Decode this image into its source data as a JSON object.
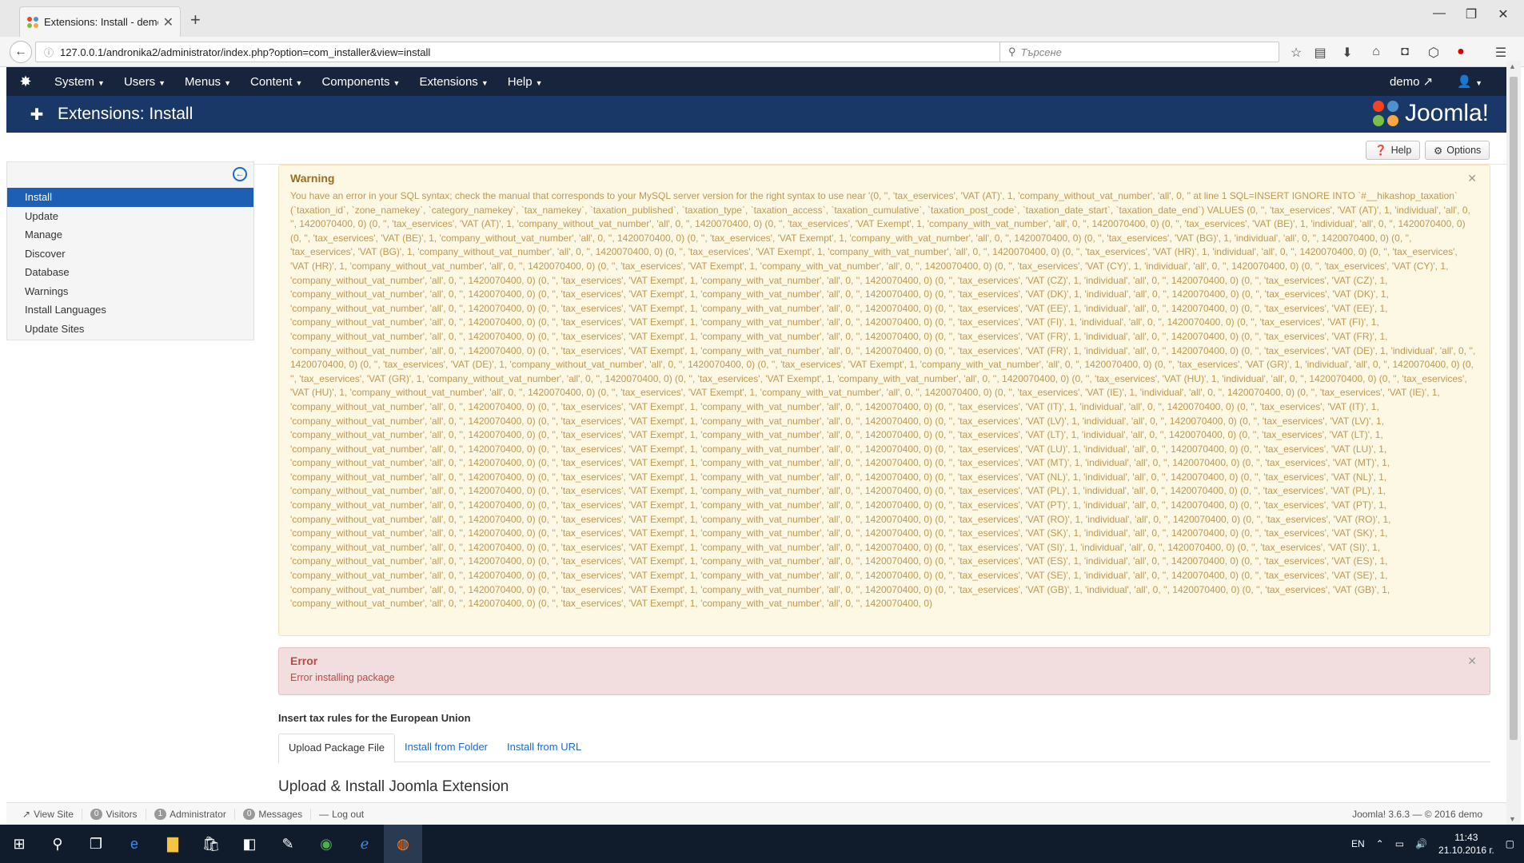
{
  "browser": {
    "tab_title": "Extensions: Install - demo ...",
    "url": "127.0.0.1/andronika2/administrator/index.php?option=com_installer&view=install",
    "search_placeholder": "Търсене"
  },
  "nav": {
    "menu": [
      {
        "label": "System"
      },
      {
        "label": "Users"
      },
      {
        "label": "Menus"
      },
      {
        "label": "Content"
      },
      {
        "label": "Components"
      },
      {
        "label": "Extensions"
      },
      {
        "label": "Help"
      }
    ],
    "user_site": "demo",
    "brand": "Joomla!"
  },
  "header": {
    "title": "Extensions: Install"
  },
  "toolbar": {
    "help_label": "Help",
    "options_label": "Options"
  },
  "sidebar": {
    "items": [
      {
        "label": "Install",
        "active": true
      },
      {
        "label": "Update"
      },
      {
        "label": "Manage"
      },
      {
        "label": "Discover"
      },
      {
        "label": "Database"
      },
      {
        "label": "Warnings"
      },
      {
        "label": "Install Languages"
      },
      {
        "label": "Update Sites"
      }
    ]
  },
  "warning": {
    "title": "Warning",
    "body": "You have an error in your SQL syntax; check the manual that corresponds to your MySQL server version for the right syntax to use near '(0, '', 'tax_eservices', 'VAT (AT)', 1, 'company_without_vat_number', 'all', 0, '' at line 1 SQL=INSERT IGNORE INTO `#__hikashop_taxation` (`taxation_id`, `zone_namekey`, `category_namekey`, `tax_namekey`, `taxation_published`, `taxation_type`, `taxation_access`, `taxation_cumulative`, `taxation_post_code`, `taxation_date_start`, `taxation_date_end`) VALUES (0, '', 'tax_eservices', 'VAT (AT)', 1, 'individual', 'all', 0, '', 1420070400, 0) (0, '', 'tax_eservices', 'VAT (AT)', 1, 'company_without_vat_number', 'all', 0, '', 1420070400, 0) (0, '', 'tax_eservices', 'VAT Exempt', 1, 'company_with_vat_number', 'all', 0, '', 1420070400, 0) (0, '', 'tax_eservices', 'VAT (BE)', 1, 'individual', 'all', 0, '', 1420070400, 0) (0, '', 'tax_eservices', 'VAT (BE)', 1, 'company_without_vat_number', 'all', 0, '', 1420070400, 0) (0, '', 'tax_eservices', 'VAT Exempt', 1, 'company_with_vat_number', 'all', 0, '', 1420070400, 0) (0, '', 'tax_eservices', 'VAT (BG)', 1, 'individual', 'all', 0, '', 1420070400, 0) (0, '', 'tax_eservices', 'VAT (BG)', 1, 'company_without_vat_number', 'all', 0, '', 1420070400, 0) (0, '', 'tax_eservices', 'VAT Exempt', 1, 'company_with_vat_number', 'all', 0, '', 1420070400, 0) (0, '', 'tax_eservices', 'VAT (HR)', 1, 'individual', 'all', 0, '', 1420070400, 0) (0, '', 'tax_eservices', 'VAT (HR)', 1, 'company_without_vat_number', 'all', 0, '', 1420070400, 0) (0, '', 'tax_eservices', 'VAT Exempt', 1, 'company_with_vat_number', 'all', 0, '', 1420070400, 0) (0, '', 'tax_eservices', 'VAT (CY)', 1, 'individual', 'all', 0, '', 1420070400, 0) (0, '', 'tax_eservices', 'VAT (CY)', 1, 'company_without_vat_number', 'all', 0, '', 1420070400, 0) (0, '', 'tax_eservices', 'VAT Exempt', 1, 'company_with_vat_number', 'all', 0, '', 1420070400, 0) (0, '', 'tax_eservices', 'VAT (CZ)', 1, 'individual', 'all', 0, '', 1420070400, 0) (0, '', 'tax_eservices', 'VAT (CZ)', 1, 'company_without_vat_number', 'all', 0, '', 1420070400, 0) (0, '', 'tax_eservices', 'VAT Exempt', 1, 'company_with_vat_number', 'all', 0, '', 1420070400, 0) (0, '', 'tax_eservices', 'VAT (DK)', 1, 'individual', 'all', 0, '', 1420070400, 0) (0, '', 'tax_eservices', 'VAT (DK)', 1, 'company_without_vat_number', 'all', 0, '', 1420070400, 0) (0, '', 'tax_eservices', 'VAT Exempt', 1, 'company_with_vat_number', 'all', 0, '', 1420070400, 0) (0, '', 'tax_eservices', 'VAT (EE)', 1, 'individual', 'all', 0, '', 1420070400, 0) (0, '', 'tax_eservices', 'VAT (EE)', 1, 'company_without_vat_number', 'all', 0, '', 1420070400, 0) (0, '', 'tax_eservices', 'VAT Exempt', 1, 'company_with_vat_number', 'all', 0, '', 1420070400, 0) (0, '', 'tax_eservices', 'VAT (FI)', 1, 'individual', 'all', 0, '', 1420070400, 0) (0, '', 'tax_eservices', 'VAT (FI)', 1, 'company_without_vat_number', 'all', 0, '', 1420070400, 0) (0, '', 'tax_eservices', 'VAT Exempt', 1, 'company_with_vat_number', 'all', 0, '', 1420070400, 0) (0, '', 'tax_eservices', 'VAT (FR)', 1, 'individual', 'all', 0, '', 1420070400, 0) (0, '', 'tax_eservices', 'VAT (FR)', 1, 'company_without_vat_number', 'all', 0, '', 1420070400, 0) (0, '', 'tax_eservices', 'VAT Exempt', 1, 'company_with_vat_number', 'all', 0, '', 1420070400, 0) (0, '', 'tax_eservices', 'VAT (FR)', 1, 'individual', 'all', 0, '', 1420070400, 0) (0, '', 'tax_eservices', 'VAT (DE)', 1, 'individual', 'all', 0, '', 1420070400, 0) (0, '', 'tax_eservices', 'VAT (DE)', 1, 'company_without_vat_number', 'all', 0, '', 1420070400, 0) (0, '', 'tax_eservices', 'VAT Exempt', 1, 'company_with_vat_number', 'all', 0, '', 1420070400, 0) (0, '', 'tax_eservices', 'VAT (GR)', 1, 'individual', 'all', 0, '', 1420070400, 0) (0, '', 'tax_eservices', 'VAT (GR)', 1, 'company_without_vat_number', 'all', 0, '', 1420070400, 0) (0, '', 'tax_eservices', 'VAT Exempt', 1, 'company_with_vat_number', 'all', 0, '', 1420070400, 0) (0, '', 'tax_eservices', 'VAT (HU)', 1, 'individual', 'all', 0, '', 1420070400, 0) (0, '', 'tax_eservices', 'VAT (HU)', 1, 'company_without_vat_number', 'all', 0, '', 1420070400, 0) (0, '', 'tax_eservices', 'VAT Exempt', 1, 'company_with_vat_number', 'all', 0, '', 1420070400, 0) (0, '', 'tax_eservices', 'VAT (IE)', 1, 'individual', 'all', 0, '', 1420070400, 0) (0, '', 'tax_eservices', 'VAT (IE)', 1, 'company_without_vat_number', 'all', 0, '', 1420070400, 0) (0, '', 'tax_eservices', 'VAT Exempt', 1, 'company_with_vat_number', 'all', 0, '', 1420070400, 0) (0, '', 'tax_eservices', 'VAT (IT)', 1, 'individual', 'all', 0, '', 1420070400, 0) (0, '', 'tax_eservices', 'VAT (IT)', 1, 'company_without_vat_number', 'all', 0, '', 1420070400, 0) (0, '', 'tax_eservices', 'VAT Exempt', 1, 'company_with_vat_number', 'all', 0, '', 1420070400, 0) (0, '', 'tax_eservices', 'VAT (LV)', 1, 'individual', 'all', 0, '', 1420070400, 0) (0, '', 'tax_eservices', 'VAT (LV)', 1, 'company_without_vat_number', 'all', 0, '', 1420070400, 0) (0, '', 'tax_eservices', 'VAT Exempt', 1, 'company_with_vat_number', 'all', 0, '', 1420070400, 0) (0, '', 'tax_eservices', 'VAT (LT)', 1, 'individual', 'all', 0, '', 1420070400, 0) (0, '', 'tax_eservices', 'VAT (LT)', 1, 'company_without_vat_number', 'all', 0, '', 1420070400, 0) (0, '', 'tax_eservices', 'VAT Exempt', 1, 'company_with_vat_number', 'all', 0, '', 1420070400, 0) (0, '', 'tax_eservices', 'VAT (LU)', 1, 'individual', 'all', 0, '', 1420070400, 0) (0, '', 'tax_eservices', 'VAT (LU)', 1, 'company_without_vat_number', 'all', 0, '', 1420070400, 0) (0, '', 'tax_eservices', 'VAT Exempt', 1, 'company_with_vat_number', 'all', 0, '', 1420070400, 0) (0, '', 'tax_eservices', 'VAT (MT)', 1, 'individual', 'all', 0, '', 1420070400, 0) (0, '', 'tax_eservices', 'VAT (MT)', 1, 'company_without_vat_number', 'all', 0, '', 1420070400, 0) (0, '', 'tax_eservices', 'VAT Exempt', 1, 'company_with_vat_number', 'all', 0, '', 1420070400, 0) (0, '', 'tax_eservices', 'VAT (NL)', 1, 'individual', 'all', 0, '', 1420070400, 0) (0, '', 'tax_eservices', 'VAT (NL)', 1, 'company_without_vat_number', 'all', 0, '', 1420070400, 0) (0, '', 'tax_eservices', 'VAT Exempt', 1, 'company_with_vat_number', 'all', 0, '', 1420070400, 0) (0, '', 'tax_eservices', 'VAT (PL)', 1, 'individual', 'all', 0, '', 1420070400, 0) (0, '', 'tax_eservices', 'VAT (PL)', 1, 'company_without_vat_number', 'all', 0, '', 1420070400, 0) (0, '', 'tax_eservices', 'VAT Exempt', 1, 'company_with_vat_number', 'all', 0, '', 1420070400, 0) (0, '', 'tax_eservices', 'VAT (PT)', 1, 'individual', 'all', 0, '', 1420070400, 0) (0, '', 'tax_eservices', 'VAT (PT)', 1, 'company_without_vat_number', 'all', 0, '', 1420070400, 0) (0, '', 'tax_eservices', 'VAT Exempt', 1, 'company_with_vat_number', 'all', 0, '', 1420070400, 0) (0, '', 'tax_eservices', 'VAT (RO)', 1, 'individual', 'all', 0, '', 1420070400, 0) (0, '', 'tax_eservices', 'VAT (RO)', 1, 'company_without_vat_number', 'all', 0, '', 1420070400, 0) (0, '', 'tax_eservices', 'VAT Exempt', 1, 'company_with_vat_number', 'all', 0, '', 1420070400, 0) (0, '', 'tax_eservices', 'VAT (SK)', 1, 'individual', 'all', 0, '', 1420070400, 0) (0, '', 'tax_eservices', 'VAT (SK)', 1, 'company_without_vat_number', 'all', 0, '', 1420070400, 0) (0, '', 'tax_eservices', 'VAT Exempt', 1, 'company_with_vat_number', 'all', 0, '', 1420070400, 0) (0, '', 'tax_eservices', 'VAT (SI)', 1, 'individual', 'all', 0, '', 1420070400, 0) (0, '', 'tax_eservices', 'VAT (SI)', 1, 'company_without_vat_number', 'all', 0, '', 1420070400, 0) (0, '', 'tax_eservices', 'VAT Exempt', 1, 'company_with_vat_number', 'all', 0, '', 1420070400, 0) (0, '', 'tax_eservices', 'VAT (ES)', 1, 'individual', 'all', 0, '', 1420070400, 0) (0, '', 'tax_eservices', 'VAT (ES)', 1, 'company_without_vat_number', 'all', 0, '', 1420070400, 0) (0, '', 'tax_eservices', 'VAT Exempt', 1, 'company_with_vat_number', 'all', 0, '', 1420070400, 0) (0, '', 'tax_eservices', 'VAT (SE)', 1, 'individual', 'all', 0, '', 1420070400, 0) (0, '', 'tax_eservices', 'VAT (SE)', 1, 'company_without_vat_number', 'all', 0, '', 1420070400, 0) (0, '', 'tax_eservices', 'VAT Exempt', 1, 'company_with_vat_number', 'all', 0, '', 1420070400, 0) (0, '', 'tax_eservices', 'VAT (GB)', 1, 'individual', 'all', 0, '', 1420070400, 0) (0, '', 'tax_eservices', 'VAT (GB)', 1, 'company_without_vat_number', 'all', 0, '', 1420070400, 0) (0, '', 'tax_eservices', 'VAT Exempt', 1, 'company_with_vat_number', 'all', 0, '', 1420070400, 0)"
  },
  "error": {
    "title": "Error",
    "body": "Error installing package"
  },
  "main": {
    "section_title": "Insert tax rules for the European Union",
    "tabs": [
      {
        "label": "Upload Package File",
        "active": true
      },
      {
        "label": "Install from Folder"
      },
      {
        "label": "Install from URL"
      }
    ],
    "upload_title": "Upload & Install Joomla Extension"
  },
  "statusbar": {
    "view_site": "View Site",
    "visitors_count": "0",
    "visitors_label": "Visitors",
    "admin_count": "1",
    "admin_label": "Administrator",
    "messages_count": "0",
    "messages_label": "Messages",
    "logout": "Log out",
    "copyright": "Joomla! 3.6.3 — © 2016 demo"
  },
  "taskbar": {
    "lang": "EN",
    "time": "11:43",
    "date": "21.10.2016 г."
  },
  "colors": {
    "nav_bg": "#17243c",
    "header_bg": "#1a3867",
    "sidebar_active": "#1d5fb5",
    "warning_bg": "#fcf8e3",
    "error_bg": "#f2dede"
  }
}
